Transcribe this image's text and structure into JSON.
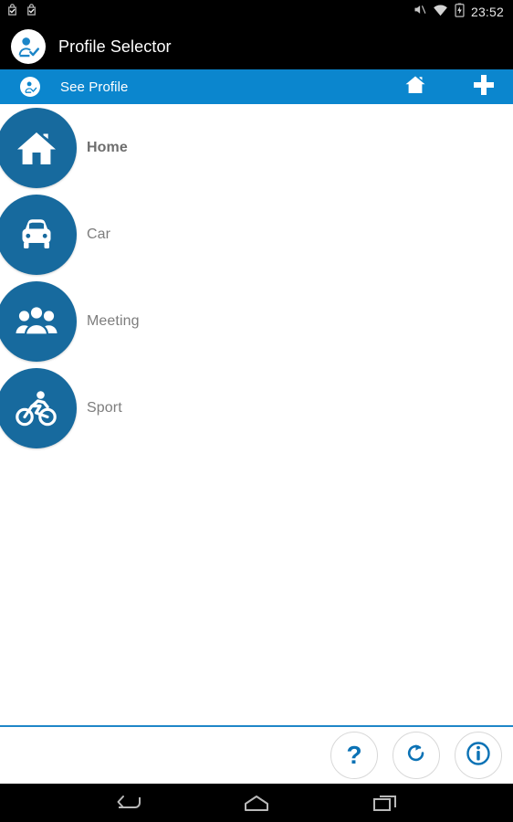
{
  "status_bar": {
    "notification_icons": [
      "app-install-icon",
      "app-install-icon"
    ],
    "system_icons": [
      "mute-icon",
      "wifi-icon",
      "battery-charging-icon"
    ],
    "time": "23:52"
  },
  "title_bar": {
    "app_icon": "profile-check-icon",
    "title": "Profile Selector"
  },
  "action_bar": {
    "icon": "profile-icon",
    "label": "See Profile",
    "home_icon": "home-icon",
    "add_icon": "plus-icon",
    "background_color": "#0b86ce"
  },
  "profiles": {
    "badge_color": "#176a9e",
    "items": [
      {
        "label": "Home",
        "icon": "house-icon",
        "selected": true
      },
      {
        "label": "Car",
        "icon": "car-icon",
        "selected": false
      },
      {
        "label": "Meeting",
        "icon": "people-group-icon",
        "selected": false
      },
      {
        "label": "Sport",
        "icon": "cyclist-icon",
        "selected": false
      }
    ]
  },
  "bottom_bar": {
    "divider_color": "#1f86c8",
    "accent_color": "#0b72b5",
    "buttons": [
      {
        "name": "help",
        "glyph": "?",
        "icon": "question-mark-icon"
      },
      {
        "name": "reset",
        "glyph": "",
        "icon": "refresh-icon"
      },
      {
        "name": "info",
        "glyph": "",
        "icon": "info-icon"
      }
    ]
  },
  "nav_bar": {
    "back_icon": "back-arrow-icon",
    "home_icon": "home-outline-icon",
    "recents_icon": "recent-apps-icon"
  }
}
